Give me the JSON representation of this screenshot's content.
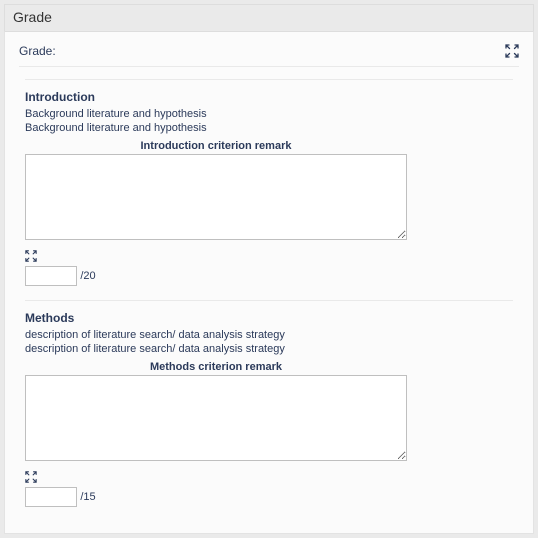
{
  "header": {
    "title": "Grade"
  },
  "panel": {
    "label": "Grade:"
  },
  "sections": [
    {
      "title": "Introduction",
      "desc1": "Background literature and hypothesis",
      "desc2": "Background literature and hypothesis",
      "remark_label": "Introduction criterion remark",
      "remark_value": "",
      "score_value": "",
      "score_max": "/20"
    },
    {
      "title": "Methods",
      "desc1": "description of literature search/ data analysis strategy",
      "desc2": "description of literature search/ data analysis strategy",
      "remark_label": "Methods criterion remark",
      "remark_value": "",
      "score_value": "",
      "score_max": "/15"
    }
  ]
}
